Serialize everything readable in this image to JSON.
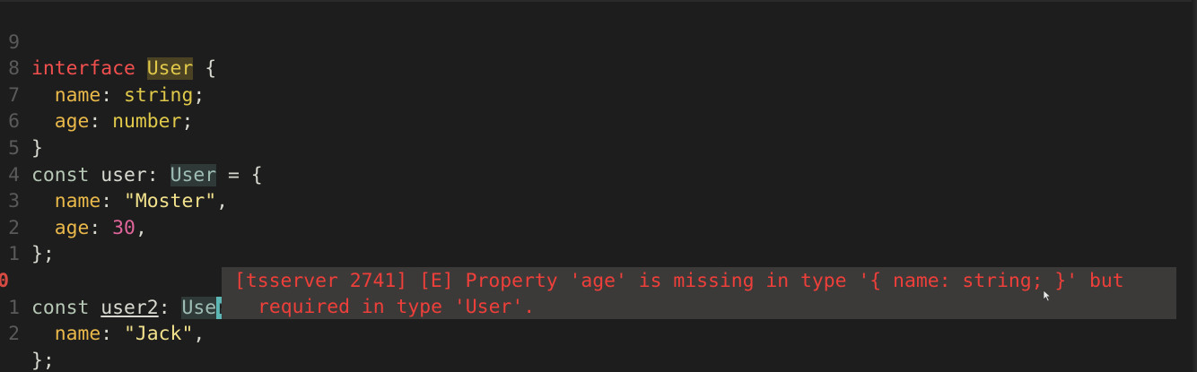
{
  "editor": {
    "lines": [
      {
        "num": "9",
        "tokens": {
          "t0": "interface",
          "t1": " ",
          "t2": "User",
          "t3": " {"
        }
      },
      {
        "num": "8",
        "tokens": {
          "t0": "  ",
          "t1": "name",
          "t2": ": ",
          "t3": "string",
          "t4": ";"
        }
      },
      {
        "num": "7",
        "tokens": {
          "t0": "  ",
          "t1": "age",
          "t2": ": ",
          "t3": "number",
          "t4": ";"
        }
      },
      {
        "num": "6",
        "tokens": {
          "t0": "}"
        }
      },
      {
        "num": "5",
        "tokens": {
          "t0": "const",
          "t1": " user: ",
          "t2": "User",
          "t3": " = {"
        }
      },
      {
        "num": "4",
        "tokens": {
          "t0": "  ",
          "t1": "name",
          "t2": ": ",
          "t3": "\"Moster\"",
          "t4": ","
        }
      },
      {
        "num": "3",
        "tokens": {
          "t0": "  ",
          "t1": "age",
          "t2": ": ",
          "t3": "30",
          "t4": ","
        }
      },
      {
        "num": "2",
        "tokens": {
          "t0": "};"
        }
      },
      {
        "num": "1",
        "tokens": {}
      },
      {
        "num": "0",
        "tokens": {
          "t0": "const",
          "t1": " ",
          "t2": "user2",
          "t3": ": ",
          "t4": "Use",
          "t5": "r",
          "t6": " = {"
        }
      },
      {
        "num": "1",
        "tokens": {
          "t0": "  ",
          "t1": "name",
          "t2": ": ",
          "t3": "\"Jack\"",
          "t4": ","
        }
      },
      {
        "num": "2",
        "tokens": {
          "t0": "};"
        }
      }
    ]
  },
  "diagnostic": {
    "line1": "[tsserver 2741] [E] Property 'age' is missing in type '{ name: string; }' but",
    "line2": "required in type 'User'."
  },
  "colors": {
    "background": "#1d1d1d",
    "keyword": "#f2504f",
    "type": "#e0c94a",
    "property": "#e9b84a",
    "string": "#f2e18c",
    "number": "#e0659b",
    "error": "#ee3f3a",
    "cursor": "#5cb6b3",
    "diagnostic_bg": "#3c3a38"
  },
  "icons": {
    "mouse_pointer": "text-cursor-icon"
  }
}
